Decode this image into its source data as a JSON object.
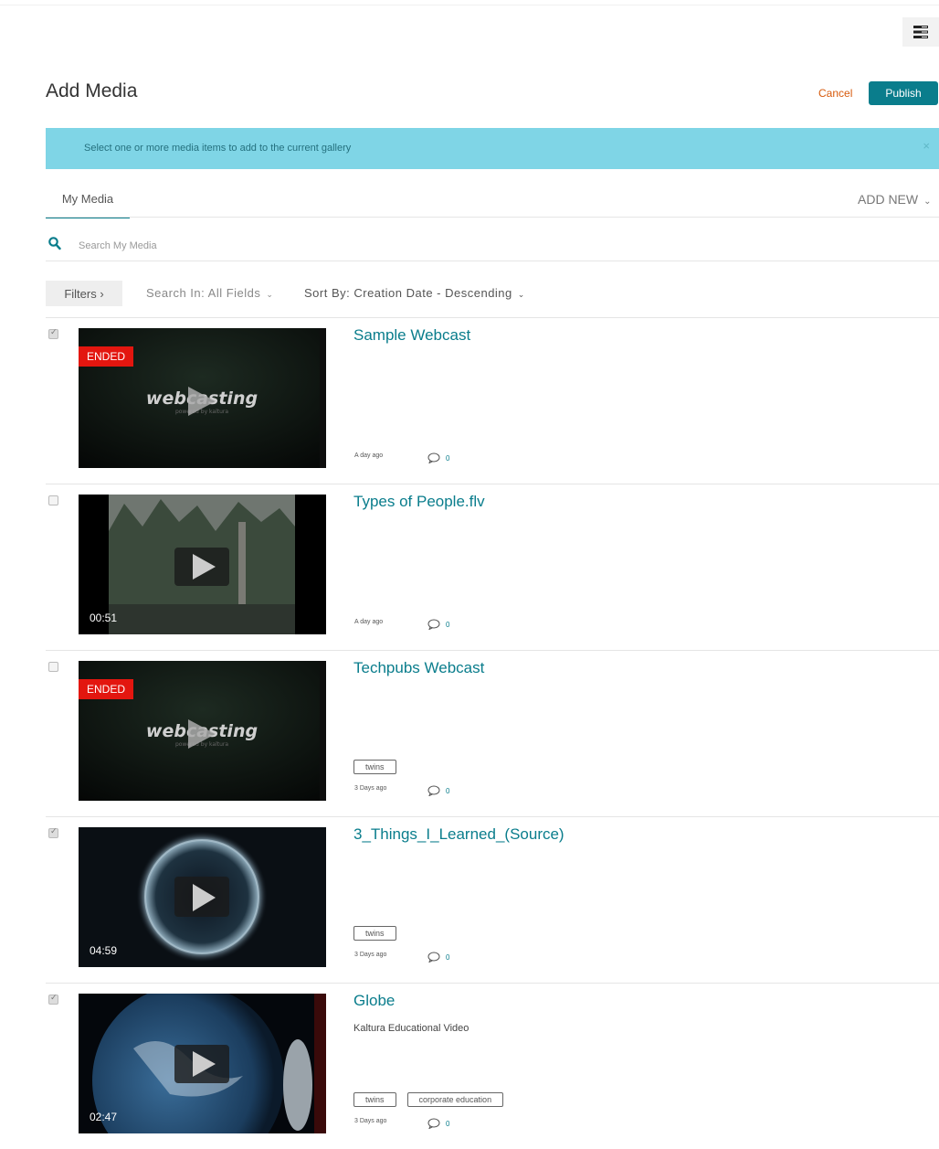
{
  "header": {
    "title": "Add Media",
    "cancel_label": "Cancel",
    "publish_label": "Publish"
  },
  "banner": {
    "text": "Select one or more media items to add to the current gallery",
    "close": "×"
  },
  "tabs": {
    "my_media": "My Media",
    "add_new": "ADD NEW"
  },
  "search": {
    "placeholder": "Search My Media"
  },
  "toolbar": {
    "filters_label": "Filters ›",
    "search_in_label": "Search In: All Fields",
    "sort_by_label": "Sort By: Creation Date - Descending"
  },
  "colors": {
    "accent": "#0a7d8c",
    "cancel": "#d75a0c",
    "banner": "#7fd5e6",
    "ended": "#e3160f"
  },
  "media": [
    {
      "title": "Sample Webcast",
      "checked": true,
      "badge": "ENDED",
      "duration": "",
      "description": "",
      "tags": [],
      "date": "A day ago",
      "comments": "0",
      "thumbnail": "webcasting"
    },
    {
      "title": "Types of People.flv",
      "checked": false,
      "badge": "",
      "duration": "00:51",
      "description": "",
      "tags": [],
      "date": "A day ago",
      "comments": "0",
      "thumbnail": "trees"
    },
    {
      "title": "Techpubs Webcast",
      "checked": false,
      "badge": "ENDED",
      "duration": "",
      "description": "",
      "tags": [
        "twins"
      ],
      "date": "3 Days ago",
      "comments": "0",
      "thumbnail": "webcasting"
    },
    {
      "title": "3_Things_I_Learned_(Source)",
      "checked": true,
      "badge": "",
      "duration": "04:59",
      "description": "",
      "tags": [
        "twins"
      ],
      "date": "3 Days ago",
      "comments": "0",
      "thumbnail": "sphere"
    },
    {
      "title": "Globe",
      "checked": true,
      "badge": "",
      "duration": "02:47",
      "description": "Kaltura Educational Video",
      "tags": [
        "twins",
        "corporate education"
      ],
      "date": "3 Days ago",
      "comments": "0",
      "thumbnail": "globe"
    }
  ],
  "thumbnail_text": {
    "webcasting_logo": "webcasting",
    "webcasting_sub": "powered by kaltura"
  }
}
